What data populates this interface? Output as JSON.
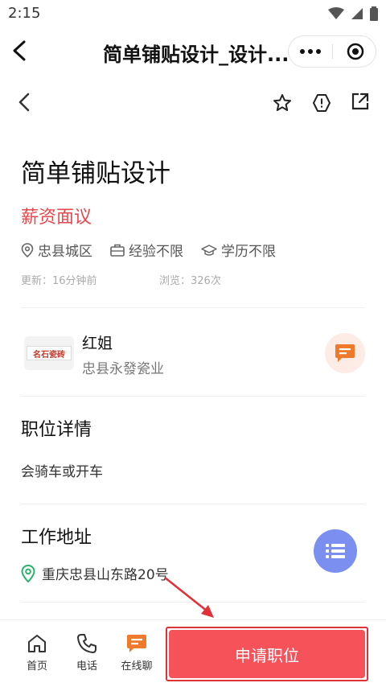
{
  "status_bar": {
    "time": "2:15"
  },
  "mini_program": {
    "title": "简单铺贴设计_设计..."
  },
  "job": {
    "title": "简单铺贴设计",
    "salary": "薪资面议",
    "tags": [
      "忠县城区",
      "经验不限",
      "学历不限"
    ],
    "updated": "更新：16分钟前",
    "views": "浏览：326次"
  },
  "employer": {
    "logo_text": "名石瓷砖",
    "contact": "红姐",
    "company": "忠县永發瓷业"
  },
  "details": {
    "heading": "职位详情",
    "description": "会骑车或开车"
  },
  "location": {
    "heading": "工作地址",
    "address": "重庆忠县山东路20号"
  },
  "bottom_bar": {
    "tabs": [
      {
        "label": "首页",
        "icon": "home-icon"
      },
      {
        "label": "电话",
        "icon": "phone-icon"
      },
      {
        "label": "在线聊",
        "icon": "chat-icon"
      }
    ],
    "apply_label": "申请职位"
  },
  "colors": {
    "accent_red": "#f5525a",
    "salary_red": "#e5484d",
    "chat_orange": "#f07a2b",
    "float_blue": "#7b8ff0",
    "location_green": "#2bb36e"
  }
}
